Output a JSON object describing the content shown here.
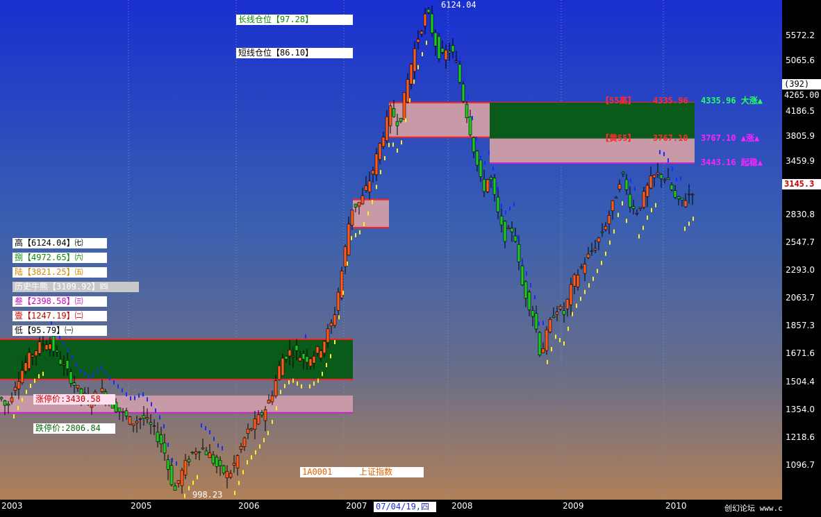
{
  "chart_data": {
    "type": "candlestick",
    "title": "上证指数",
    "code": "1A0001",
    "log_scale": true,
    "ylim": [
      985,
      6300
    ],
    "x_ticks": [
      "2003",
      "2005",
      "2006",
      "2007",
      "2008",
      "2009",
      "2010"
    ],
    "y_ticks": [
      5572.2,
      5065.6,
      4186.5,
      3805.9,
      3459.9,
      2830.8,
      2547.7,
      2293.0,
      2063.7,
      1857.3,
      1671.6,
      1504.4,
      1354.0,
      1218.6,
      1096.7
    ],
    "cursor_date": "07/04/19,四",
    "current_price": "3145.3",
    "right_top_value": "4265.00",
    "right_top_count": "(392)",
    "peak": "6124.04",
    "trough": "998.23",
    "long_position": "长线仓位【97.28】",
    "short_position": "短线仓位【86.10】",
    "levels": [
      {
        "text": "高【6124.04】㈦",
        "color": "#000000"
      },
      {
        "text": "捌【4972.65】㈥",
        "color": "#0a8a0a"
      },
      {
        "text": "陆【3821.25】㈤",
        "color": "#d08a00"
      },
      {
        "text": "历史牛熊【3109.92】㈣",
        "color": "#ffffff"
      },
      {
        "text": "叁【2398.58】㈢",
        "color": "#cc00cc"
      },
      {
        "text": "壹【1247.19】㈡",
        "color": "#cc0000"
      },
      {
        "text": "低【95.79】㈠",
        "color": "#000000"
      }
    ],
    "limit_up_label": "涨停价:3430.58",
    "limit_down_label": "跌停价:2806.84",
    "zones": [
      {
        "label": "【55高】",
        "value": "4335.96",
        "right_text": "4335.96 大涨▲",
        "color": "#22ff66"
      },
      {
        "label": "【黄55】",
        "value": "3767.10",
        "right_text": "3767.10 ▲涨▲",
        "color": "#ff22ff"
      },
      {
        "label": "",
        "value": "",
        "right_text": "3443.16 起稳▲",
        "color": "#ff22ff"
      }
    ],
    "footer": "创幻论坛 www.chuangx.com",
    "series_close_path": [
      [
        0,
        1420
      ],
      [
        10,
        1360
      ],
      [
        20,
        1480
      ],
      [
        30,
        1560
      ],
      [
        40,
        1640
      ],
      [
        55,
        1720
      ],
      [
        70,
        1760
      ],
      [
        85,
        1640
      ],
      [
        100,
        1540
      ],
      [
        115,
        1440
      ],
      [
        130,
        1400
      ],
      [
        145,
        1460
      ],
      [
        160,
        1390
      ],
      [
        175,
        1340
      ],
      [
        190,
        1290
      ],
      [
        205,
        1320
      ],
      [
        220,
        1260
      ],
      [
        235,
        1180
      ],
      [
        245,
        1050
      ],
      [
        252,
        998
      ],
      [
        260,
        1060
      ],
      [
        270,
        1120
      ],
      [
        285,
        1180
      ],
      [
        300,
        1150
      ],
      [
        315,
        1080
      ],
      [
        330,
        1060
      ],
      [
        340,
        1120
      ],
      [
        355,
        1240
      ],
      [
        370,
        1300
      ],
      [
        385,
        1380
      ],
      [
        395,
        1480
      ],
      [
        405,
        1640
      ],
      [
        420,
        1700
      ],
      [
        440,
        1640
      ],
      [
        460,
        1700
      ],
      [
        480,
        1900
      ],
      [
        495,
        2400
      ],
      [
        505,
        2900
      ],
      [
        520,
        2980
      ],
      [
        535,
        3300
      ],
      [
        550,
        3800
      ],
      [
        562,
        4200
      ],
      [
        575,
        4000
      ],
      [
        585,
        4600
      ],
      [
        595,
        5200
      ],
      [
        605,
        5700
      ],
      [
        615,
        6124
      ],
      [
        625,
        5500
      ],
      [
        635,
        5100
      ],
      [
        645,
        5300
      ],
      [
        655,
        5150
      ],
      [
        665,
        4500
      ],
      [
        675,
        4000
      ],
      [
        685,
        3500
      ],
      [
        695,
        3100
      ],
      [
        705,
        3300
      ],
      [
        715,
        2900
      ],
      [
        725,
        2600
      ],
      [
        740,
        2700
      ],
      [
        750,
        2200
      ],
      [
        760,
        2050
      ],
      [
        770,
        1900
      ],
      [
        778,
        1664
      ],
      [
        790,
        1850
      ],
      [
        800,
        2000
      ],
      [
        812,
        1950
      ],
      [
        825,
        2200
      ],
      [
        840,
        2350
      ],
      [
        855,
        2500
      ],
      [
        870,
        2700
      ],
      [
        885,
        3000
      ],
      [
        895,
        3350
      ],
      [
        905,
        3000
      ],
      [
        915,
        2850
      ],
      [
        925,
        3000
      ],
      [
        935,
        3200
      ],
      [
        945,
        3300
      ],
      [
        955,
        3280
      ],
      [
        965,
        3150
      ],
      [
        975,
        2950
      ],
      [
        985,
        3000
      ],
      [
        1000,
        3145
      ]
    ]
  }
}
